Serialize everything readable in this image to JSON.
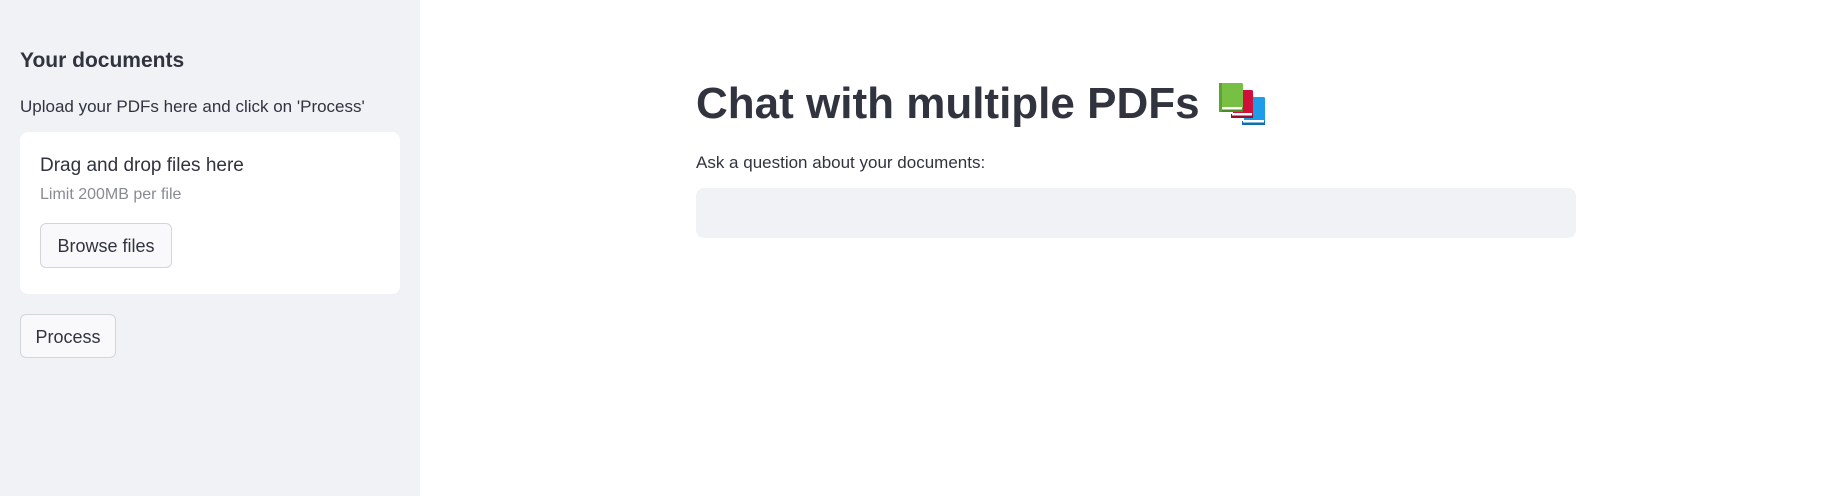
{
  "sidebar": {
    "heading": "Your documents",
    "caption": "Upload your PDFs here and click on 'Process'",
    "uploader": {
      "title": "Drag and drop files here",
      "limit": "Limit 200MB per file",
      "browse_label": "Browse files"
    },
    "process_label": "Process"
  },
  "main": {
    "title": "Chat with multiple PDFs",
    "title_icon": "books-icon",
    "question_label": "Ask a question about your documents:",
    "question_value": "",
    "question_placeholder": ""
  },
  "colors": {
    "sidebar_bg": "#f0f2f6",
    "text": "#31333f",
    "muted_text": "#898b93",
    "input_bg": "#f0f2f6",
    "book_green": "#78c043",
    "book_red": "#d0103a",
    "book_blue": "#1e9be9"
  }
}
